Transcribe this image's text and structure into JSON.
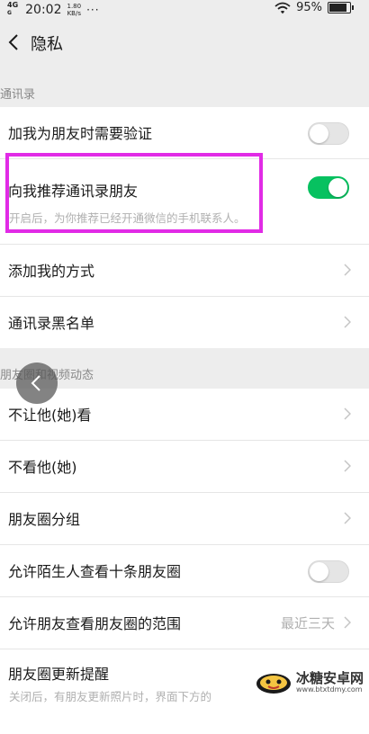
{
  "status_bar": {
    "network": "4G",
    "network2": "G",
    "time": "20:02",
    "speed_value": "1.80",
    "speed_unit": "KB/s",
    "dots": "···",
    "battery": "95%"
  },
  "nav": {
    "title": "隐私"
  },
  "sections": {
    "contacts_header": "通讯录",
    "moments_header": "朋友圈和视频动态"
  },
  "contacts": {
    "verify_label": "加我为朋友时需要验证",
    "verify_on": false,
    "recommend_label": "向我推荐通讯录朋友",
    "recommend_on": true,
    "recommend_desc": "开启后，为你推荐已经开通微信的手机联系人。",
    "add_methods_label": "添加我的方式",
    "blacklist_label": "通讯录黑名单"
  },
  "moments": {
    "hide_mine_label": "不让他(她)看",
    "hide_theirs_label": "不看他(她)",
    "groups_label": "朋友圈分组",
    "strangers_label": "允许陌生人查看十条朋友圈",
    "strangers_on": false,
    "range_label": "允许朋友查看朋友圈的范围",
    "range_value": "最近三天",
    "update_label": "朋友圈更新提醒",
    "update_desc": "关闭后，有朋友更新照片时，界面下方的"
  },
  "watermark": {
    "name": "冰糖安卓网",
    "url": "www.btxtdmy.com"
  },
  "colors": {
    "accent": "#07c160",
    "highlight": "#e12be6",
    "background": "#ededed"
  },
  "icons": {
    "back": "chevron-left-icon",
    "row_arrow": "chevron-right-icon",
    "wifi": "wifi-icon",
    "battery": "battery-icon"
  }
}
